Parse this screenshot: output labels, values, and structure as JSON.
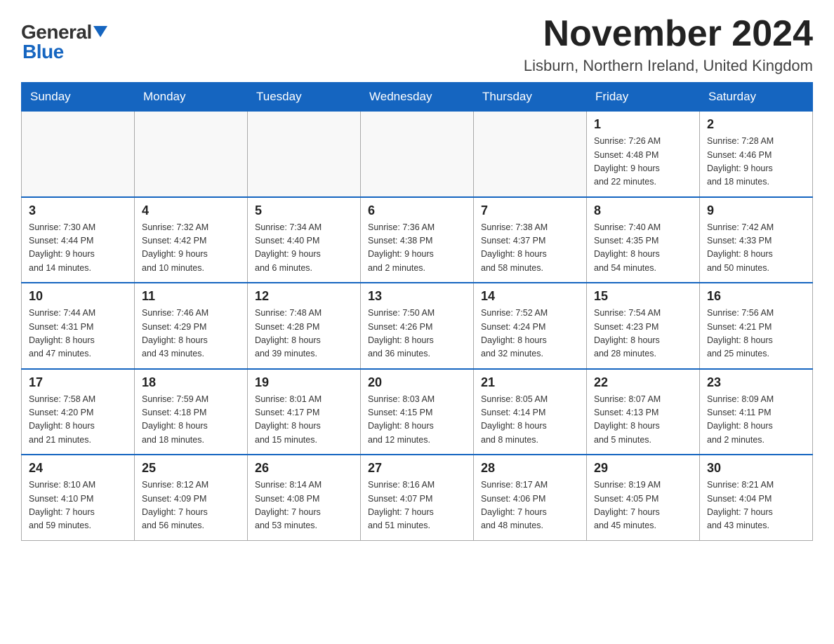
{
  "logo": {
    "general": "General",
    "blue": "Blue"
  },
  "header": {
    "month_year": "November 2024",
    "location": "Lisburn, Northern Ireland, United Kingdom"
  },
  "weekdays": [
    "Sunday",
    "Monday",
    "Tuesday",
    "Wednesday",
    "Thursday",
    "Friday",
    "Saturday"
  ],
  "weeks": [
    [
      {
        "day": "",
        "info": ""
      },
      {
        "day": "",
        "info": ""
      },
      {
        "day": "",
        "info": ""
      },
      {
        "day": "",
        "info": ""
      },
      {
        "day": "",
        "info": ""
      },
      {
        "day": "1",
        "info": "Sunrise: 7:26 AM\nSunset: 4:48 PM\nDaylight: 9 hours\nand 22 minutes."
      },
      {
        "day": "2",
        "info": "Sunrise: 7:28 AM\nSunset: 4:46 PM\nDaylight: 9 hours\nand 18 minutes."
      }
    ],
    [
      {
        "day": "3",
        "info": "Sunrise: 7:30 AM\nSunset: 4:44 PM\nDaylight: 9 hours\nand 14 minutes."
      },
      {
        "day": "4",
        "info": "Sunrise: 7:32 AM\nSunset: 4:42 PM\nDaylight: 9 hours\nand 10 minutes."
      },
      {
        "day": "5",
        "info": "Sunrise: 7:34 AM\nSunset: 4:40 PM\nDaylight: 9 hours\nand 6 minutes."
      },
      {
        "day": "6",
        "info": "Sunrise: 7:36 AM\nSunset: 4:38 PM\nDaylight: 9 hours\nand 2 minutes."
      },
      {
        "day": "7",
        "info": "Sunrise: 7:38 AM\nSunset: 4:37 PM\nDaylight: 8 hours\nand 58 minutes."
      },
      {
        "day": "8",
        "info": "Sunrise: 7:40 AM\nSunset: 4:35 PM\nDaylight: 8 hours\nand 54 minutes."
      },
      {
        "day": "9",
        "info": "Sunrise: 7:42 AM\nSunset: 4:33 PM\nDaylight: 8 hours\nand 50 minutes."
      }
    ],
    [
      {
        "day": "10",
        "info": "Sunrise: 7:44 AM\nSunset: 4:31 PM\nDaylight: 8 hours\nand 47 minutes."
      },
      {
        "day": "11",
        "info": "Sunrise: 7:46 AM\nSunset: 4:29 PM\nDaylight: 8 hours\nand 43 minutes."
      },
      {
        "day": "12",
        "info": "Sunrise: 7:48 AM\nSunset: 4:28 PM\nDaylight: 8 hours\nand 39 minutes."
      },
      {
        "day": "13",
        "info": "Sunrise: 7:50 AM\nSunset: 4:26 PM\nDaylight: 8 hours\nand 36 minutes."
      },
      {
        "day": "14",
        "info": "Sunrise: 7:52 AM\nSunset: 4:24 PM\nDaylight: 8 hours\nand 32 minutes."
      },
      {
        "day": "15",
        "info": "Sunrise: 7:54 AM\nSunset: 4:23 PM\nDaylight: 8 hours\nand 28 minutes."
      },
      {
        "day": "16",
        "info": "Sunrise: 7:56 AM\nSunset: 4:21 PM\nDaylight: 8 hours\nand 25 minutes."
      }
    ],
    [
      {
        "day": "17",
        "info": "Sunrise: 7:58 AM\nSunset: 4:20 PM\nDaylight: 8 hours\nand 21 minutes."
      },
      {
        "day": "18",
        "info": "Sunrise: 7:59 AM\nSunset: 4:18 PM\nDaylight: 8 hours\nand 18 minutes."
      },
      {
        "day": "19",
        "info": "Sunrise: 8:01 AM\nSunset: 4:17 PM\nDaylight: 8 hours\nand 15 minutes."
      },
      {
        "day": "20",
        "info": "Sunrise: 8:03 AM\nSunset: 4:15 PM\nDaylight: 8 hours\nand 12 minutes."
      },
      {
        "day": "21",
        "info": "Sunrise: 8:05 AM\nSunset: 4:14 PM\nDaylight: 8 hours\nand 8 minutes."
      },
      {
        "day": "22",
        "info": "Sunrise: 8:07 AM\nSunset: 4:13 PM\nDaylight: 8 hours\nand 5 minutes."
      },
      {
        "day": "23",
        "info": "Sunrise: 8:09 AM\nSunset: 4:11 PM\nDaylight: 8 hours\nand 2 minutes."
      }
    ],
    [
      {
        "day": "24",
        "info": "Sunrise: 8:10 AM\nSunset: 4:10 PM\nDaylight: 7 hours\nand 59 minutes."
      },
      {
        "day": "25",
        "info": "Sunrise: 8:12 AM\nSunset: 4:09 PM\nDaylight: 7 hours\nand 56 minutes."
      },
      {
        "day": "26",
        "info": "Sunrise: 8:14 AM\nSunset: 4:08 PM\nDaylight: 7 hours\nand 53 minutes."
      },
      {
        "day": "27",
        "info": "Sunrise: 8:16 AM\nSunset: 4:07 PM\nDaylight: 7 hours\nand 51 minutes."
      },
      {
        "day": "28",
        "info": "Sunrise: 8:17 AM\nSunset: 4:06 PM\nDaylight: 7 hours\nand 48 minutes."
      },
      {
        "day": "29",
        "info": "Sunrise: 8:19 AM\nSunset: 4:05 PM\nDaylight: 7 hours\nand 45 minutes."
      },
      {
        "day": "30",
        "info": "Sunrise: 8:21 AM\nSunset: 4:04 PM\nDaylight: 7 hours\nand 43 minutes."
      }
    ]
  ]
}
